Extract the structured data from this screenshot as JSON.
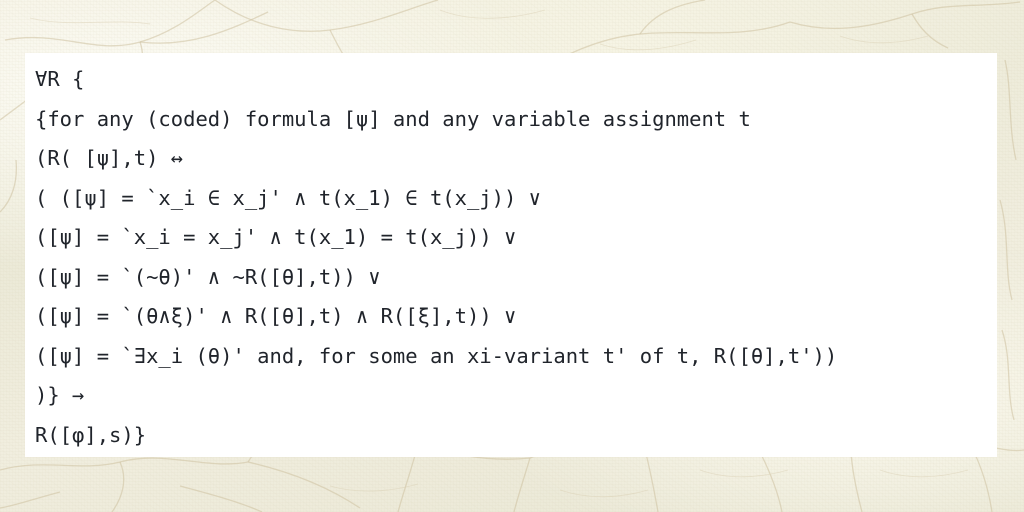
{
  "background": {
    "style": "parchment-paper-texture",
    "base_color": "#f0eddc",
    "vein_color": "#cfc3a2"
  },
  "panel": {
    "background_color": "#ffffff",
    "text_color": "#20242b"
  },
  "formula": {
    "title": "universal-recursion-schema",
    "lines": [
      "∀R {",
      "{for any (coded) formula [ψ] and any variable assignment t",
      "(R( [ψ],t) ↔",
      "( ([ψ] = `x_i ∈ x_j' ∧ t(x_1) ∈ t(x_j)) ∨",
      "([ψ] = `x_i = x_j' ∧ t(x_1) = t(x_j)) ∨",
      "([ψ] = `(~θ)' ∧ ~R([θ],t)) ∨",
      "([ψ] = `(θ∧ξ)' ∧ R([θ],t) ∧ R([ξ],t)) ∨",
      "([ψ] = `∃x_i (θ)' and, for some an xi-variant t' of t, R([θ],t'))",
      ")} →",
      "R([φ],s)}"
    ]
  }
}
